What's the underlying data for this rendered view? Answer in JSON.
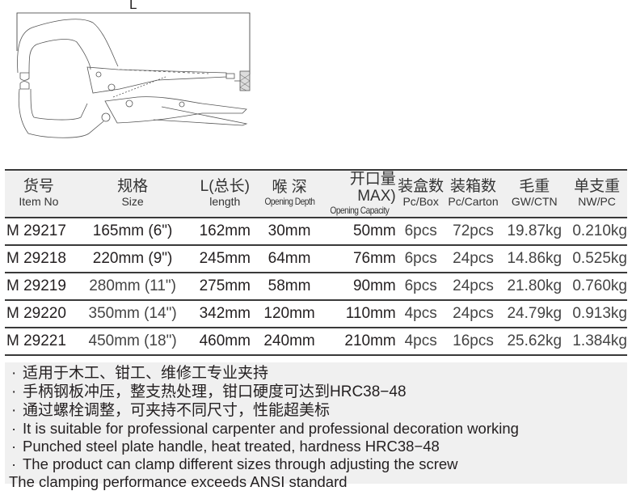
{
  "diagram": {
    "dimension_label": "L",
    "subject": "c-clamp-locking-pliers-drawing"
  },
  "table": {
    "headers": [
      {
        "cn": "货号",
        "en": "Item No"
      },
      {
        "cn": "规格",
        "en": "Size"
      },
      {
        "cn": "L(总长)",
        "en": "length"
      },
      {
        "cn": "喉 深",
        "en": "Opening Depth"
      },
      {
        "cn": "开口量MAX)",
        "en": "Opening Capacity"
      },
      {
        "cn": "装盒数",
        "en": "Pc/Box"
      },
      {
        "cn": "装箱数",
        "en": "Pc/Carton"
      },
      {
        "cn": "毛重",
        "en": "GW/CTN"
      },
      {
        "cn": "单支重",
        "en": "NW/PC"
      }
    ],
    "rows": [
      {
        "item": "M 29217",
        "size": "165mm (6\")",
        "length": "162mm",
        "depth": "30mm",
        "capacity": "50mm",
        "box": "6pcs",
        "carton": "72pcs",
        "gw": "19.87kg",
        "nw": "0.210kg"
      },
      {
        "item": "M 29218",
        "size": "220mm (9\")",
        "length": "245mm",
        "depth": "64mm",
        "capacity": "76mm",
        "box": "6pcs",
        "carton": "24pcs",
        "gw": "14.86kg",
        "nw": "0.525kg"
      },
      {
        "item": "M 29219",
        "size": "280mm (11\")",
        "length": "275mm",
        "depth": "58mm",
        "capacity": "90mm",
        "box": "6pcs",
        "carton": "24pcs",
        "gw": "21.80kg",
        "nw": "0.760kg"
      },
      {
        "item": "M 29220",
        "size": "350mm (14\")",
        "length": "342mm",
        "depth": "120mm",
        "capacity": "110mm",
        "box": "4pcs",
        "carton": "24pcs",
        "gw": "24.79kg",
        "nw": "0.913kg"
      },
      {
        "item": "M 29221",
        "size": "450mm (18\")",
        "length": "460mm",
        "depth": "240mm",
        "capacity": "210mm",
        "box": "4pcs",
        "carton": "16pcs",
        "gw": "25.62kg",
        "nw": "1.384kg"
      }
    ]
  },
  "notes": {
    "bullet": "·",
    "cn": [
      "适用于木工、钳工、维修工专业夹持",
      "手柄钢板冲压，整支热处理，钳口硬度可达到HRC38−48",
      "通过螺栓调整，可夹持不同尺寸，性能超美标"
    ],
    "en": [
      "It is suitable for professional carpenter and professional decoration working",
      "Punched steel plate handle, heat treated, hardness HRC38−48",
      "The product can clamp different sizes through adjusting the screw"
    ],
    "en_last": "The clamping performance exceeds ANSI standard"
  }
}
